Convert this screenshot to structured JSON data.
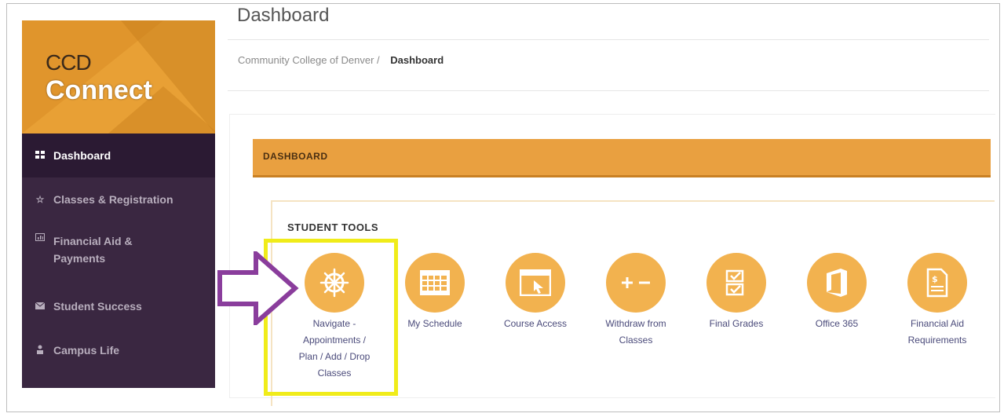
{
  "page": {
    "title": "Dashboard"
  },
  "breadcrumb": {
    "parent": "Community College of Denver /",
    "current": "Dashboard"
  },
  "logo": {
    "line1": "CCD",
    "line2": "Connect"
  },
  "sidebar": {
    "items": [
      {
        "label": "Dashboard",
        "icon": "grid-icon",
        "active": true
      },
      {
        "label": "Classes & Registration",
        "icon": "star-icon"
      },
      {
        "label": "Financial Aid & Payments",
        "icon": "chart-icon"
      },
      {
        "label": "Student Success",
        "icon": "envelope-icon"
      },
      {
        "label": "Campus Life",
        "icon": "person-icon"
      }
    ]
  },
  "dashboard": {
    "header": "DASHBOARD",
    "section_title": "STUDENT TOOLS"
  },
  "tools": [
    {
      "label": "Navigate - Appointments / Plan / Add / Drop Classes",
      "icon": "ship-wheel-icon"
    },
    {
      "label": "My Schedule",
      "icon": "calendar-icon"
    },
    {
      "label": "Course Access",
      "icon": "browser-window-icon"
    },
    {
      "label": "Withdraw from Classes",
      "icon": "plus-minus-icon"
    },
    {
      "label": "Final Grades",
      "icon": "checklist-icon"
    },
    {
      "label": "Office 365",
      "icon": "office-icon"
    },
    {
      "label": "Financial Aid Requirements",
      "icon": "dollar-document-icon"
    }
  ],
  "colors": {
    "accent": "#e9a040",
    "icon_circle": "#f2b24f",
    "sidebar_bg": "#3a2741",
    "highlight": "#f0ec1a",
    "arrow": "#8a3d9c"
  }
}
